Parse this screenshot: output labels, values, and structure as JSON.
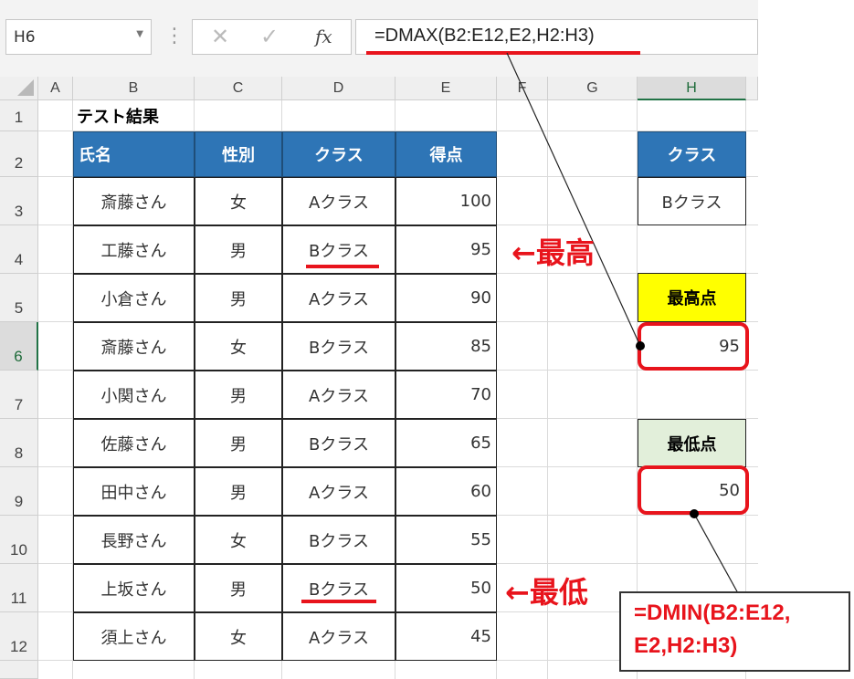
{
  "formula_bar": {
    "name_box": "H6",
    "formula": "=DMAX(B2:E12,E2,H2:H3)"
  },
  "columns": [
    "A",
    "B",
    "C",
    "D",
    "E",
    "F",
    "G",
    "H"
  ],
  "rows": [
    "1",
    "2",
    "3",
    "4",
    "5",
    "6",
    "7",
    "8",
    "9",
    "10",
    "11",
    "12"
  ],
  "sheet": {
    "title": "テスト結果",
    "headers": [
      "氏名",
      "性別",
      "クラス",
      "得点"
    ],
    "records": [
      [
        "斎藤さん",
        "女",
        "Aクラス",
        "100"
      ],
      [
        "工藤さん",
        "男",
        "Bクラス",
        "95"
      ],
      [
        "小倉さん",
        "男",
        "Aクラス",
        "90"
      ],
      [
        "斎藤さん",
        "女",
        "Bクラス",
        "85"
      ],
      [
        "小関さん",
        "男",
        "Aクラス",
        "70"
      ],
      [
        "佐藤さん",
        "男",
        "Bクラス",
        "65"
      ],
      [
        "田中さん",
        "男",
        "Aクラス",
        "60"
      ],
      [
        "長野さん",
        "女",
        "Bクラス",
        "55"
      ],
      [
        "上坂さん",
        "男",
        "Bクラス",
        "50"
      ],
      [
        "須上さん",
        "女",
        "Aクラス",
        "45"
      ]
    ]
  },
  "criteria": {
    "header": "クラス",
    "value": "Bクラス"
  },
  "max_block": {
    "label": "最高点",
    "value": "95"
  },
  "min_block": {
    "label": "最低点",
    "value": "50"
  },
  "annotations": {
    "highest": "←最高",
    "lowest": "←最低",
    "dmin_line1": "=DMIN(B2:E12,",
    "dmin_line2": "E2,H2:H3)"
  },
  "colors": {
    "header_blue": "#2e75b6",
    "max_yellow": "#ffff00",
    "min_green": "#e2efda",
    "annotation_red": "#e8141c"
  }
}
